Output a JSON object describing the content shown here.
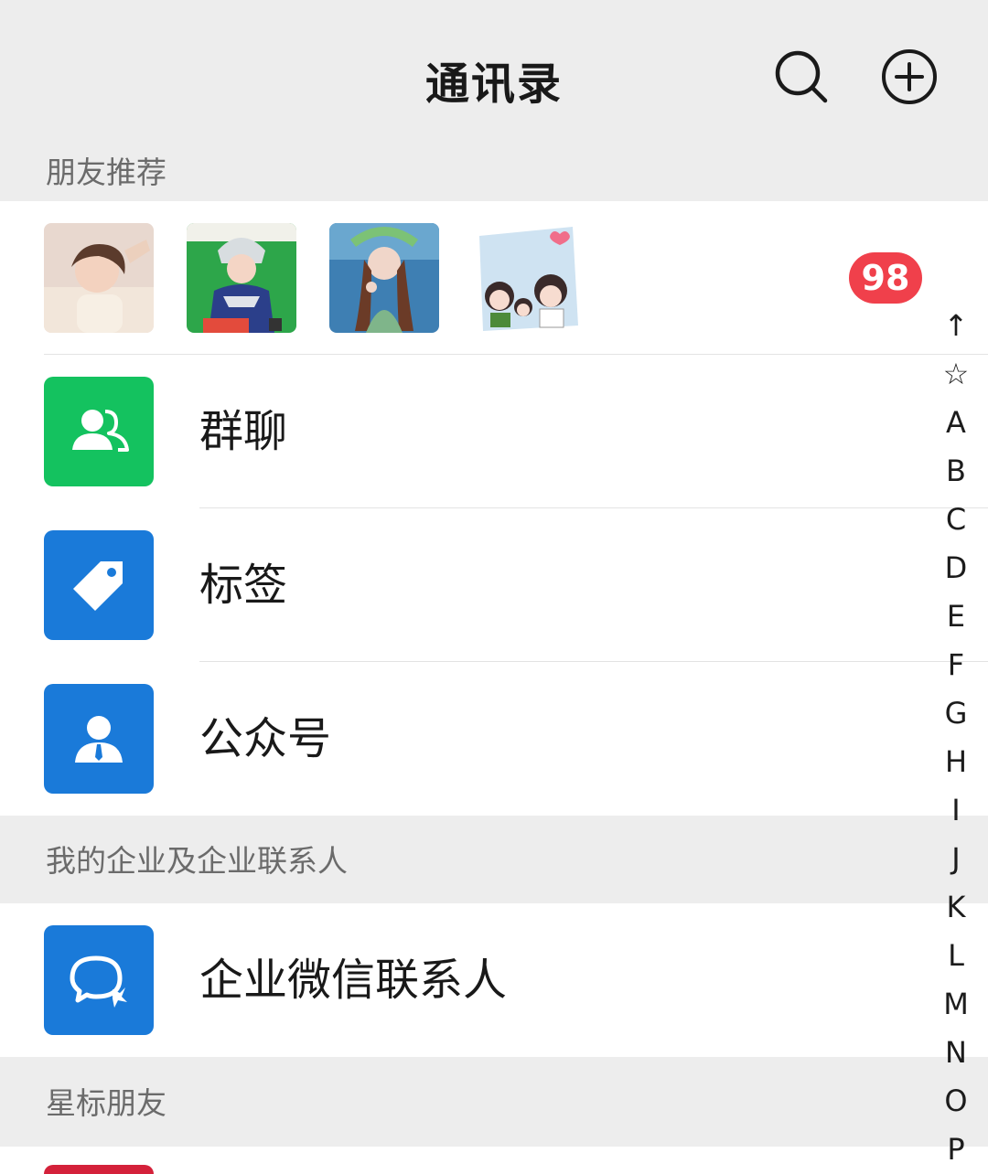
{
  "header": {
    "title": "通讯录",
    "search_icon": "search-icon",
    "add_icon": "add-circle-icon"
  },
  "sections": {
    "friend_recommend": "朋友推荐",
    "enterprise": "我的企业及企业联系人",
    "starred": "星标朋友"
  },
  "recommend": {
    "badge": "98",
    "avatars": [
      "avatar-girl-photo",
      "avatar-costume-photo",
      "avatar-flower-crown-photo",
      "avatar-cartoon-family"
    ]
  },
  "rows": {
    "group_chat": "群聊",
    "tags": "标签",
    "official_accounts": "公众号",
    "wecom_contacts": "企业微信联系人"
  },
  "index_bar": [
    "↑",
    "☆",
    "A",
    "B",
    "C",
    "D",
    "E",
    "F",
    "G",
    "H",
    "I",
    "J",
    "K",
    "L",
    "M",
    "N",
    "O",
    "P"
  ],
  "colors": {
    "background": "#ededed",
    "panel": "#ffffff",
    "green_icon": "#14c25f",
    "blue_icon": "#1a7ad9",
    "badge": "#f0404b"
  }
}
